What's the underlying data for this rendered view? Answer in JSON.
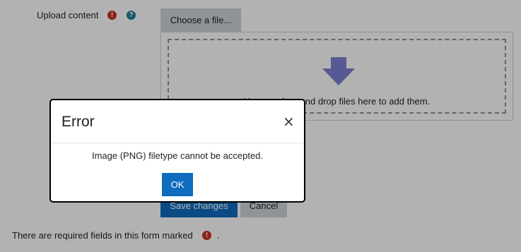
{
  "form": {
    "upload_label": "Upload content",
    "required_icon": "exclamation-circle-icon",
    "help_icon": "question-circle-icon",
    "choose_file_label": "Choose a file...",
    "drop_text": "You can drag and drop files here to add them.",
    "drop_arrow_icon": "down-arrow-icon",
    "save_label": "Save changes",
    "cancel_label": "Cancel",
    "required_note": "There are required fields in this form marked",
    "required_note_end": "."
  },
  "dialog": {
    "title": "Error",
    "close_glyph": "×",
    "message": "Image (PNG) filetype cannot be accepted.",
    "ok_label": "OK"
  },
  "colors": {
    "primary": "#0f6cbf",
    "required": "#ca3120",
    "help": "#1f7e9a",
    "secondary_button": "#ced4da",
    "overlay": "rgba(0,0,0,0.30)"
  }
}
